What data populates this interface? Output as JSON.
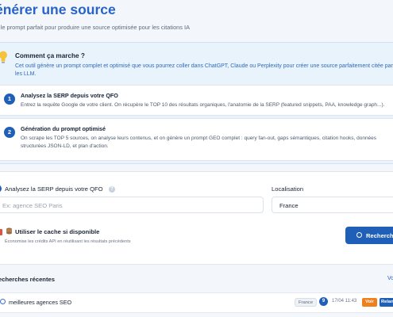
{
  "header": {
    "title": "énérer une source",
    "subtitle": "z le prompt parfait pour produire une source optimisée pour les citations IA"
  },
  "howto": {
    "icon": "lightbulb-icon",
    "title": "Comment ça marche ?",
    "description": "Cet outil génère un prompt complet et optimisé que vous pourrez coller dans ChatGPT, Claude ou Perplexity pour créer une source parfaitement citée par les LLM.",
    "steps": [
      {
        "number": "1",
        "title": "Analysez la SERP depuis votre QFO",
        "description": "Entrez la requête Google de votre client. On récupère le TOP 10 des résultats organiques, l'anatomie de la SERP (featured snippets, PAA, knowledge graph...)."
      },
      {
        "number": "2",
        "title": "Génération du prompt optimisé",
        "description": "On scrape les TOP 5 sources, on analyse leurs contenus, et on génère un prompt GEO complet : query fan-out, gaps sémantiques, citation hooks, données structurées JSON-LD, et plan d'action."
      }
    ]
  },
  "form": {
    "query_label": "Analysez la SERP depuis votre QFO",
    "query_help": "?",
    "query_placeholder": "Ex: agence SEO Paris",
    "location_label": "Localisation",
    "location_value": "France",
    "cache_label": "Utiliser le cache si disponible",
    "cache_description": "Économise les crédits API en réutilisant les résultats précédents",
    "search_button": "Recherche"
  },
  "recent": {
    "heading": "echerches récentes",
    "view_all": "Vo",
    "items": [
      {
        "query": "meilleures agences SEO",
        "location": "France",
        "count": "9",
        "date": "17/04 11:43",
        "view_label": "Voir",
        "rerun_label": "Relancer"
      }
    ]
  },
  "colors": {
    "accent": "#1f5fb8",
    "title": "#2763c9",
    "info_bg": "#e9f3fc",
    "orange": "#f07f1e",
    "red": "#e0533f",
    "page_bg": "#f3f6fa"
  }
}
